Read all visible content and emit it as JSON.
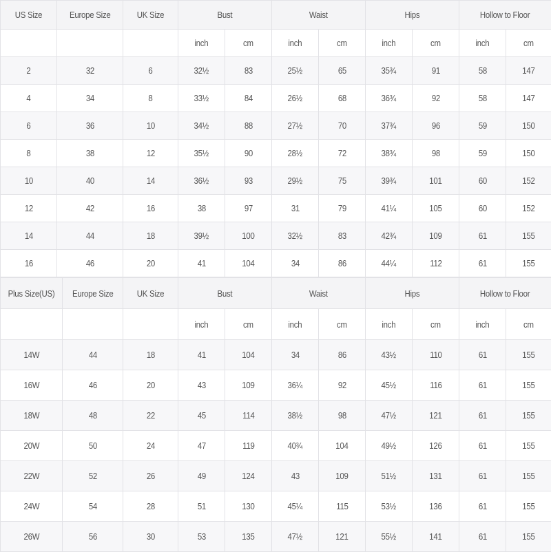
{
  "tables": [
    {
      "headers": [
        "US Size",
        "Europe Size",
        "UK Size",
        "Bust",
        "Waist",
        "Hips",
        "Hollow to Floor"
      ],
      "units": [
        "inch",
        "cm",
        "inch",
        "cm",
        "inch",
        "cm",
        "inch",
        "cm"
      ],
      "rows": [
        [
          "2",
          "32",
          "6",
          "32½",
          "83",
          "25½",
          "65",
          "35¾",
          "91",
          "58",
          "147"
        ],
        [
          "4",
          "34",
          "8",
          "33½",
          "84",
          "26½",
          "68",
          "36¾",
          "92",
          "58",
          "147"
        ],
        [
          "6",
          "36",
          "10",
          "34½",
          "88",
          "27½",
          "70",
          "37¾",
          "96",
          "59",
          "150"
        ],
        [
          "8",
          "38",
          "12",
          "35½",
          "90",
          "28½",
          "72",
          "38¾",
          "98",
          "59",
          "150"
        ],
        [
          "10",
          "40",
          "14",
          "36½",
          "93",
          "29½",
          "75",
          "39¾",
          "101",
          "60",
          "152"
        ],
        [
          "12",
          "42",
          "16",
          "38",
          "97",
          "31",
          "79",
          "41¼",
          "105",
          "60",
          "152"
        ],
        [
          "14",
          "44",
          "18",
          "39½",
          "100",
          "32½",
          "83",
          "42¾",
          "109",
          "61",
          "155"
        ],
        [
          "16",
          "46",
          "20",
          "41",
          "104",
          "34",
          "86",
          "44¼",
          "112",
          "61",
          "155"
        ]
      ]
    },
    {
      "headers": [
        "Plus Size(US)",
        "Europe Size",
        "UK Size",
        "Bust",
        "Waist",
        "Hips",
        "Hollow to Floor"
      ],
      "units": [
        "inch",
        "cm",
        "inch",
        "cm",
        "inch",
        "cm",
        "inch",
        "cm"
      ],
      "rows": [
        [
          "14W",
          "44",
          "18",
          "41",
          "104",
          "34",
          "86",
          "43½",
          "110",
          "61",
          "155"
        ],
        [
          "16W",
          "46",
          "20",
          "43",
          "109",
          "36¼",
          "92",
          "45½",
          "116",
          "61",
          "155"
        ],
        [
          "18W",
          "48",
          "22",
          "45",
          "114",
          "38½",
          "98",
          "47½",
          "121",
          "61",
          "155"
        ],
        [
          "20W",
          "50",
          "24",
          "47",
          "119",
          "40¾",
          "104",
          "49½",
          "126",
          "61",
          "155"
        ],
        [
          "22W",
          "52",
          "26",
          "49",
          "124",
          "43",
          "109",
          "51½",
          "131",
          "61",
          "155"
        ],
        [
          "24W",
          "54",
          "28",
          "51",
          "130",
          "45¼",
          "115",
          "53½",
          "136",
          "61",
          "155"
        ],
        [
          "26W",
          "56",
          "30",
          "53",
          "135",
          "47½",
          "121",
          "55½",
          "141",
          "61",
          "155"
        ]
      ]
    }
  ]
}
